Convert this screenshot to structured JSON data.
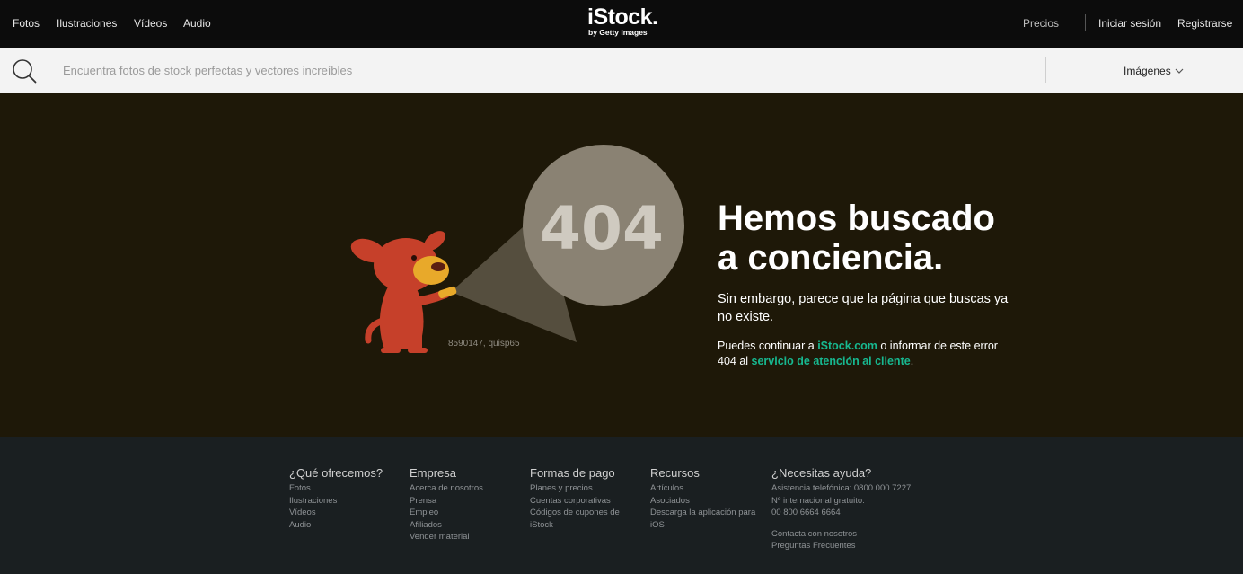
{
  "nav": {
    "fotos": "Fotos",
    "ilustraciones": "Ilustraciones",
    "videos": "Vídeos",
    "audio": "Audio",
    "precios": "Precios",
    "login": "Iniciar sesión",
    "register": "Registrarse"
  },
  "logo": {
    "main": "iStock.",
    "sub": "by Getty Images"
  },
  "search": {
    "placeholder": "Encuentra fotos de stock perfectas y vectores increíbles",
    "type": "Imágenes"
  },
  "hero": {
    "code": "404",
    "headline_1": "Hemos buscado",
    "headline_2": "a conciencia.",
    "sub": "Sin embargo, parece que la página que buscas ya no existe.",
    "cont_1": "Puedes continuar a ",
    "cont_link_1": "iStock.com",
    "cont_2": " o informar de este error 404 al ",
    "cont_link_2": "servicio de atención al cliente",
    "cont_3": ".",
    "credit": "8590147, quisp65"
  },
  "footer": {
    "col1": {
      "title": "¿Qué ofrecemos?",
      "items": [
        "Fotos",
        "Ilustraciones",
        "Vídeos",
        "Audio"
      ]
    },
    "col2": {
      "title": "Empresa",
      "items": [
        "Acerca de nosotros",
        "Prensa",
        "Empleo",
        "Afiliados",
        "Vender material"
      ]
    },
    "col3": {
      "title": "Formas de pago",
      "items": [
        "Planes y precios",
        "Cuentas corporativas",
        "Códigos de cupones de iStock"
      ]
    },
    "col4": {
      "title": "Recursos",
      "items": [
        "Artículos",
        "Asociados",
        "Descarga la aplicación para iOS"
      ]
    },
    "col5": {
      "title": "¿Necesitas ayuda?",
      "items": [
        "Asistencia telefónica: 0800 000 7227",
        "Nº internacional gratuito:",
        "00 800 6664 6664"
      ],
      "items2": [
        "Contacta con nosotros",
        "Preguntas Frecuentes"
      ]
    }
  },
  "colors": {
    "accent": "#17b890",
    "hero_bg": "#1e1808",
    "footer_bg": "#1a1f21",
    "dog": "#c6402a"
  }
}
